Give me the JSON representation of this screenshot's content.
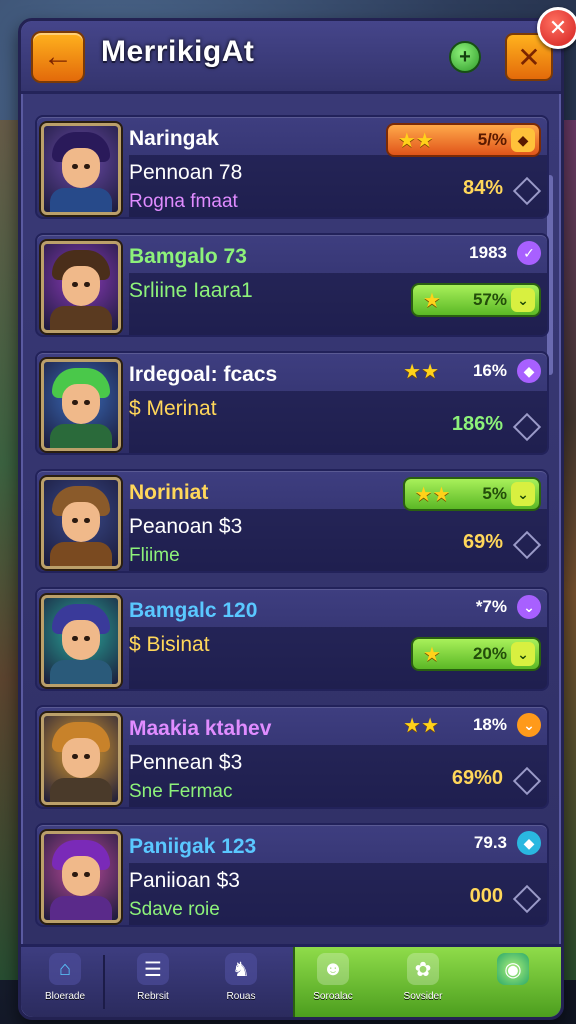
{
  "header": {
    "title": "MerrikigAt",
    "back_label": "←",
    "plus_label": "+",
    "tools_label": "✕",
    "close_label": "✕"
  },
  "cards": [
    {
      "name": "Naringak",
      "name_color": "#ffffff",
      "line2": "Pennoan 78",
      "line3": "Rogna fmaat",
      "line3_color": "#e08cff",
      "pill_style": "orange",
      "pill_stars": "★★",
      "pill_text": "5/%",
      "pill_icon": "◆",
      "stat": "84%",
      "stat_color": "#ffd75a",
      "avatar_hair": "#2a1a5a",
      "avatar_body": "#274a8a",
      "avatar_bg": "#6b4aa8"
    },
    {
      "name": "Bamgalo 73",
      "name_color": "#8df27a",
      "line2": "Srliine Iaara1",
      "line3": "",
      "line2_color": "#8df27a",
      "top_stat": "1983",
      "top_icon": "✓",
      "top_icon_color": "#a860ff",
      "pill_style": "green",
      "pill_stars": "★",
      "pill_text": "57%",
      "pill_icon": "⌄",
      "avatar_hair": "#4a2e1a",
      "avatar_body": "#5a3a20",
      "avatar_bg": "#8a3ab8"
    },
    {
      "name": "Irdegoal: fcacs",
      "name_color": "#ffffff",
      "line2": "$ Merinat",
      "line2_color": "#ffd75a",
      "top_stars": "★★",
      "top_stat": "16%",
      "top_icon": "◆",
      "top_icon_color": "#a860ff",
      "stat": "186%",
      "stat_color": "#8df27a",
      "avatar_hair": "#4ac84a",
      "avatar_body": "#2a6a3a",
      "avatar_bg": "#3a6ab8"
    },
    {
      "name": "Noriniat",
      "name_color": "#ffd75a",
      "line2": "Peanoan $3",
      "line3": "Fliime",
      "line3_color": "#8df27a",
      "pill_style": "green",
      "pill_stars": "★★",
      "pill_text": "5%",
      "pill_icon": "⌄",
      "stat": "69%",
      "stat_color": "#ffd75a",
      "avatar_hair": "#8a5a2a",
      "avatar_body": "#7a4a20",
      "avatar_bg": "#3a4a8a"
    },
    {
      "name": "Bamgalc 120",
      "name_color": "#5ac8ff",
      "line2": "$ Bisinat",
      "line2_color": "#ffd75a",
      "top_stat": "*7%",
      "top_icon": "⌄",
      "top_icon_color": "#a860ff",
      "pill_style": "green",
      "pill_stars": "★",
      "pill_text": "20%",
      "pill_icon": "⌄",
      "avatar_hair": "#3a3a9a",
      "avatar_body": "#2a5a7a",
      "avatar_bg": "#2aa89a"
    },
    {
      "name": "Maakia ktahev",
      "name_color": "#e08cff",
      "line2": "Pennean $3",
      "line3": "Sne Fermac",
      "line3_color": "#8df27a",
      "top_stars": "★★",
      "top_stat": "18%",
      "top_icon": "⌄",
      "top_icon_color": "#ff9a1a",
      "stat": "69%0",
      "stat_color": "#ffd75a",
      "avatar_hair": "#c8822a",
      "avatar_body": "#4a3a2a",
      "avatar_bg": "#e0a030"
    },
    {
      "name": "Paniigak 123",
      "name_color": "#5ac8ff",
      "line2": "Paniioan $3",
      "line3": "Sdave roie",
      "line3_color": "#8df27a",
      "top_stat": "79.3",
      "top_icon": "◆",
      "top_icon_color": "#2ab8e0",
      "stat": "000",
      "stat_color": "#ffd75a",
      "avatar_hair": "#7a2ab8",
      "avatar_body": "#5a2a8a",
      "avatar_bg": "#b84a9a"
    }
  ],
  "nav": [
    {
      "label": "Bloerade",
      "icon": "⌂"
    },
    {
      "label": "Rebrsit",
      "icon": "☰"
    },
    {
      "label": "Rouas",
      "icon": "♞"
    },
    {
      "label": "Soroalac",
      "icon": "☻"
    },
    {
      "label": "Sovsider",
      "icon": "✿"
    },
    {
      "label": "",
      "icon": "◉"
    }
  ],
  "colors": {
    "panel": "#34346e",
    "accent_orange": "#e36a0a",
    "accent_green": "#5bb826"
  }
}
